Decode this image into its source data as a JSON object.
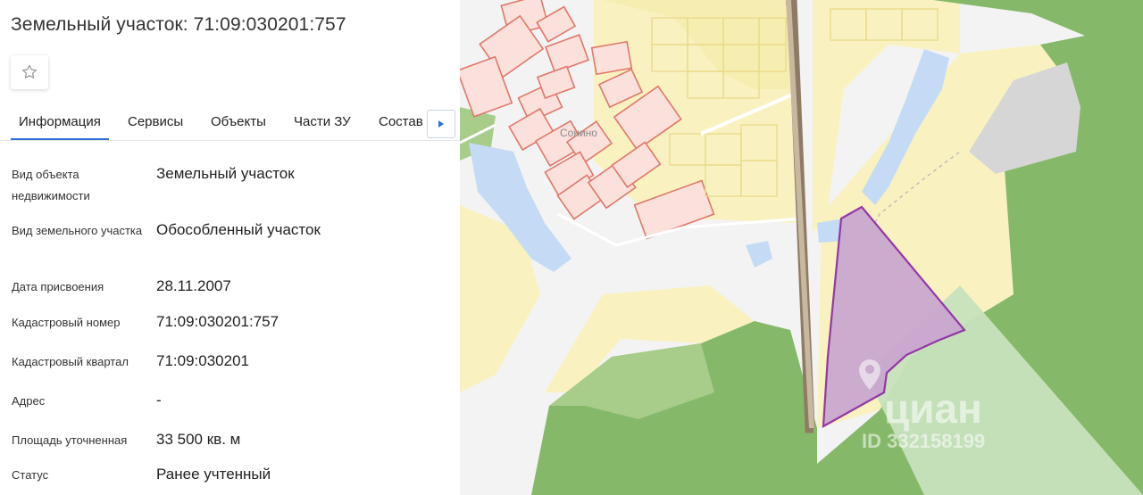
{
  "header": {
    "title": "Земельный участок: 71:09:030201:757"
  },
  "tabs": [
    {
      "label": "Информация",
      "active": true
    },
    {
      "label": "Сервисы",
      "active": false
    },
    {
      "label": "Объекты",
      "active": false
    },
    {
      "label": "Части ЗУ",
      "active": false
    },
    {
      "label": "Состав",
      "active": false
    }
  ],
  "info": [
    {
      "label": "Вид объекта недвижимости",
      "value": "Земельный участок"
    },
    {
      "label": "Вид земельного участка",
      "value": "Обособленный участок"
    },
    {
      "label": "Дата присвоения",
      "value": "28.11.2007"
    },
    {
      "label": "Кадастровый номер",
      "value": "71:09:030201:757"
    },
    {
      "label": "Кадастровый квартал",
      "value": "71:09:030201"
    },
    {
      "label": "Адрес",
      "value": "-"
    },
    {
      "label": "Площадь уточненная",
      "value": "33 500 кв. м"
    },
    {
      "label": "Статус",
      "value": "Ранее учтенный"
    }
  ],
  "map": {
    "village_label": "Сонино",
    "watermark_brand": "циан",
    "watermark_id": "ID 332158199"
  },
  "icons": {
    "favorite": "star-outline-icon",
    "tab_scroll": "triangle-right-icon",
    "watermark": "map-pin-icon"
  },
  "colors": {
    "accent": "#2d6fd6",
    "forest": "#86b86a",
    "field": "#f9f2c0",
    "water": "#c5dbf5",
    "parcel_selected": "#c9a8cf",
    "parcel_outline": "#8e2fa3",
    "building_outline": "#e0786a"
  }
}
